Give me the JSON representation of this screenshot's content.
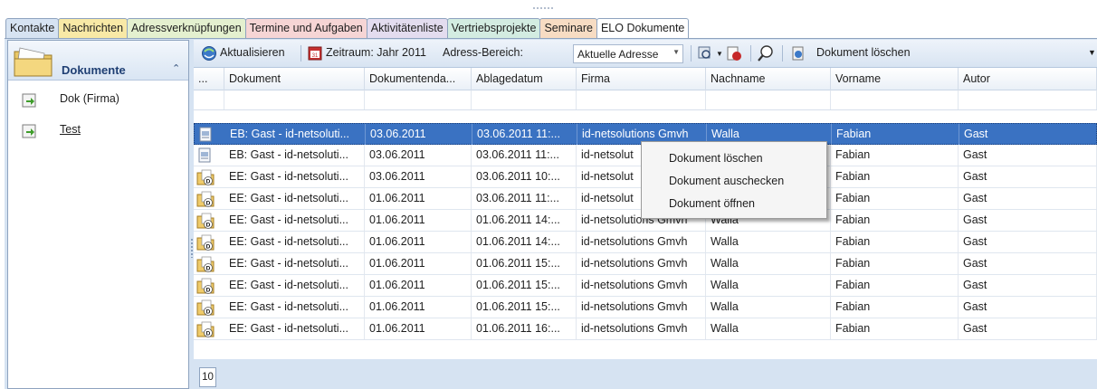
{
  "tabs": [
    {
      "label": "Kontakte",
      "color": "#d6e3f2"
    },
    {
      "label": "Nachrichten",
      "color": "#f8e9a6"
    },
    {
      "label": "Adressverknüpfungen",
      "color": "#e4f0cf"
    },
    {
      "label": "Termine und Aufgaben",
      "color": "#f6d5d5"
    },
    {
      "label": "Aktivitätenliste",
      "color": "#e3dcef"
    },
    {
      "label": "Vertriebsprojekte",
      "color": "#d3ece1"
    },
    {
      "label": "Seminare",
      "color": "#f7dcc3"
    },
    {
      "label": "ELO Dokumente",
      "color": "#ffffff"
    }
  ],
  "sidebar": {
    "title": "Dokumente",
    "items": [
      {
        "label": "Dok (Firma)",
        "icon": "document-arrow-icon"
      },
      {
        "label": "Test",
        "icon": "document-arrow-icon"
      }
    ]
  },
  "toolbar": {
    "refresh_label": "Aktualisieren",
    "zeitraum_label": "Zeitraum: Jahr 2011",
    "bereich_label": "Adress-Bereich:",
    "bereich_value": "Aktuelle Adresse",
    "delete_label": "Dokument löschen"
  },
  "grid": {
    "columns": [
      "...",
      "Dokument",
      "Dokumentenda...",
      "Ablagedatum",
      "Firma",
      "Nachname",
      "Vorname",
      "Autor"
    ],
    "rows": [
      {
        "icon": "scanned-document-icon",
        "dokument": "EB: Gast - id-netsoluti...",
        "datum": "03.06.2011",
        "ablage": "03.06.2011 11:...",
        "firma": "id-netsolutions Gmvh",
        "nachname": "Walla",
        "vorname": "Fabian",
        "autor": "Gast",
        "selected": true
      },
      {
        "icon": "scanned-document-icon",
        "dokument": "EB: Gast - id-netsoluti...",
        "datum": "03.06.2011",
        "ablage": "03.06.2011 11:...",
        "firma": "id-netsolut",
        "nachname": "",
        "vorname": "Fabian",
        "autor": "Gast",
        "selected": false
      },
      {
        "icon": "elo-document-icon",
        "dokument": "EE: Gast - id-netsoluti...",
        "datum": "03.06.2011",
        "ablage": "03.06.2011 10:...",
        "firma": "id-netsolut",
        "nachname": "",
        "vorname": "Fabian",
        "autor": "Gast",
        "selected": false
      },
      {
        "icon": "elo-document-icon",
        "dokument": "EE: Gast - id-netsoluti...",
        "datum": "01.06.2011",
        "ablage": "03.06.2011 11:...",
        "firma": "id-netsolut",
        "nachname": "",
        "vorname": "Fabian",
        "autor": "Gast",
        "selected": false
      },
      {
        "icon": "elo-document-icon",
        "dokument": "EE: Gast - id-netsoluti...",
        "datum": "01.06.2011",
        "ablage": "01.06.2011 14:...",
        "firma": "id-netsolutions Gmvh",
        "nachname": "Walla",
        "vorname": "Fabian",
        "autor": "Gast",
        "selected": false
      },
      {
        "icon": "elo-document-icon",
        "dokument": "EE: Gast - id-netsoluti...",
        "datum": "01.06.2011",
        "ablage": "01.06.2011 14:...",
        "firma": "id-netsolutions Gmvh",
        "nachname": "Walla",
        "vorname": "Fabian",
        "autor": "Gast",
        "selected": false
      },
      {
        "icon": "elo-document-icon",
        "dokument": "EE: Gast - id-netsoluti...",
        "datum": "01.06.2011",
        "ablage": "01.06.2011 15:...",
        "firma": "id-netsolutions Gmvh",
        "nachname": "Walla",
        "vorname": "Fabian",
        "autor": "Gast",
        "selected": false
      },
      {
        "icon": "elo-document-icon",
        "dokument": "EE: Gast - id-netsoluti...",
        "datum": "01.06.2011",
        "ablage": "01.06.2011 15:...",
        "firma": "id-netsolutions Gmvh",
        "nachname": "Walla",
        "vorname": "Fabian",
        "autor": "Gast",
        "selected": false
      },
      {
        "icon": "elo-document-icon",
        "dokument": "EE: Gast - id-netsoluti...",
        "datum": "01.06.2011",
        "ablage": "01.06.2011 15:...",
        "firma": "id-netsolutions Gmvh",
        "nachname": "Walla",
        "vorname": "Fabian",
        "autor": "Gast",
        "selected": false
      },
      {
        "icon": "elo-document-icon",
        "dokument": "EE: Gast - id-netsoluti...",
        "datum": "01.06.2011",
        "ablage": "01.06.2011 16:...",
        "firma": "id-netsolutions Gmvh",
        "nachname": "Walla",
        "vorname": "Fabian",
        "autor": "Gast",
        "selected": false
      }
    ]
  },
  "context_menu": {
    "items": [
      "Dokument löschen",
      "Dokument auschecken",
      "Dokument öffnen"
    ]
  },
  "pager": {
    "count": "10"
  },
  "colors": {
    "accent": "#3a72c2",
    "frame": "#d6e3f2",
    "border": "#8ea3bf"
  }
}
